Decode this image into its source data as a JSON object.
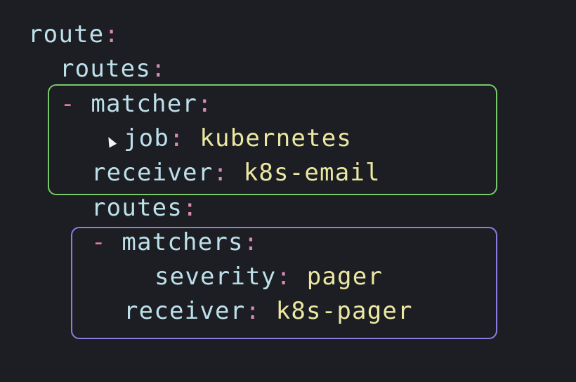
{
  "colors": {
    "background": "#1c1e23",
    "key": "#bde0ea",
    "colon": "#d98bb0",
    "value": "#ece7a1",
    "green_box": "#79c96a",
    "purple_box": "#8c7ee0"
  },
  "code": {
    "line1": {
      "key": "route",
      "colon": ":"
    },
    "line2": {
      "key": "routes",
      "colon": ":"
    },
    "line3": {
      "dash": "-",
      "key": "matcher",
      "colon": ":"
    },
    "line4": {
      "key": "job",
      "colon": ":",
      "value": "kubernetes"
    },
    "line5": {
      "key": "receiver",
      "colon": ":",
      "value": "k8s-email"
    },
    "line6": {
      "key": "routes",
      "colon": ":"
    },
    "line7": {
      "dash": "-",
      "key": "matchers",
      "colon": ":"
    },
    "line8": {
      "key": "severity",
      "colon": ":",
      "value": "pager"
    },
    "line9": {
      "key": "receiver",
      "colon": ":",
      "value": "k8s-pager"
    }
  },
  "icons": {
    "cursor": "mouse-pointer-icon"
  }
}
